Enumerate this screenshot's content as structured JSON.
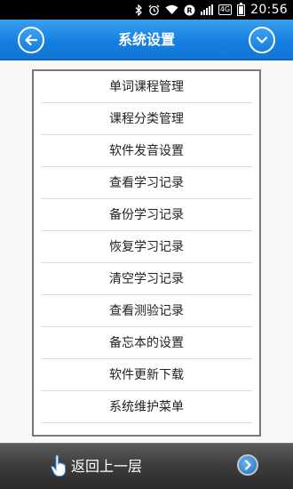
{
  "status_bar": {
    "time": "20:56",
    "signal_badge": "4G",
    "icons": [
      "bluetooth-icon",
      "alarm-icon",
      "wifi-icon",
      "data-icon",
      "signal-icon",
      "battery-icon"
    ]
  },
  "header": {
    "title": "系统设置",
    "back_icon": "arrow-left-icon",
    "menu_icon": "chevron-down-icon",
    "accent_color": "#1580e0"
  },
  "menu": {
    "items": [
      "单词课程管理",
      "课程分类管理",
      "软件发音设置",
      "查看学习记录",
      "备份学习记录",
      "恢复学习记录",
      "清空学习记录",
      "查看测验记录",
      "备忘本的设置",
      "软件更新下载",
      "系统维护菜单"
    ]
  },
  "footer": {
    "return_label": "返回上一层",
    "hand_icon": "pointing-hand-icon",
    "forward_icon": "chevron-right-icon"
  }
}
